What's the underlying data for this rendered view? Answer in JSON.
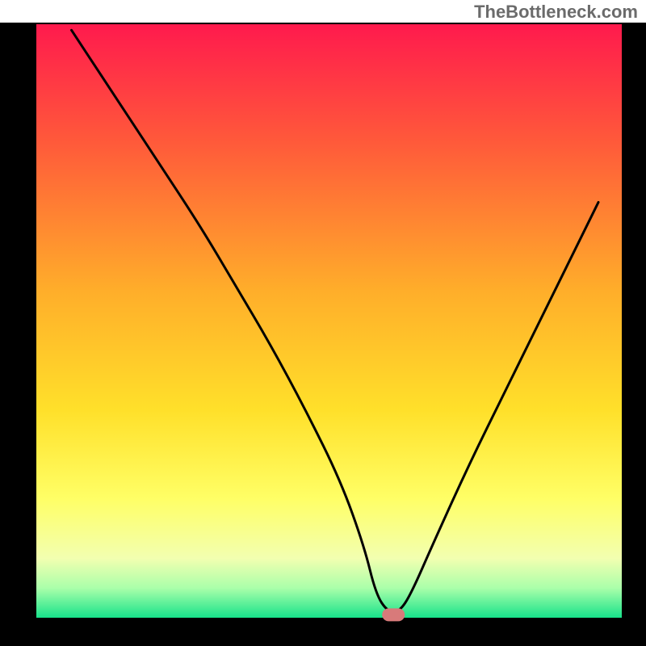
{
  "watermark": "TheBottleneck.com",
  "chart_data": {
    "type": "line",
    "title": "",
    "xlabel": "",
    "ylabel": "",
    "xlim": [
      0,
      100
    ],
    "ylim": [
      0,
      100
    ],
    "note": "Bottleneck curve overlaid on a vertical heat gradient (red=high bottleneck at top, green=zero at bottom). A small pink marker sits at the curve minimum. Surrounding black frame with thick left/right/bottom borders.",
    "series": [
      {
        "name": "bottleneck-curve",
        "x": [
          6,
          12,
          20,
          28,
          34,
          40,
          46,
          52,
          56,
          58,
          60,
          62,
          64,
          68,
          74,
          80,
          86,
          92,
          96
        ],
        "y": [
          99,
          90,
          78,
          66,
          56,
          46,
          35,
          23,
          12,
          4,
          1,
          1,
          4,
          13,
          26,
          38,
          50,
          62,
          70
        ]
      }
    ],
    "marker": {
      "x": 61,
      "y": 0.5
    },
    "gradient_stops": [
      {
        "offset": 0.0,
        "color": "#ff1a4d"
      },
      {
        "offset": 0.2,
        "color": "#ff5a3a"
      },
      {
        "offset": 0.45,
        "color": "#ffae2a"
      },
      {
        "offset": 0.65,
        "color": "#ffe02a"
      },
      {
        "offset": 0.8,
        "color": "#ffff66"
      },
      {
        "offset": 0.9,
        "color": "#f2ffb0"
      },
      {
        "offset": 0.95,
        "color": "#aaffaa"
      },
      {
        "offset": 1.0,
        "color": "#17e28a"
      }
    ],
    "frame": {
      "outer_size": 800,
      "border_left": 45,
      "border_right": 30,
      "border_top": 30,
      "border_bottom": 35,
      "border_color": "#000000"
    }
  }
}
